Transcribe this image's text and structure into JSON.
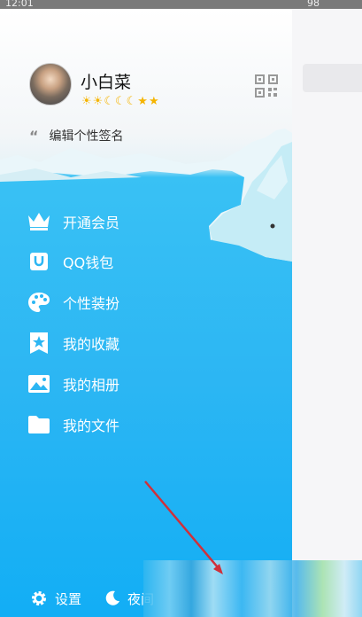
{
  "status": {
    "time": "12:01",
    "battery": "98"
  },
  "profile": {
    "name": "小白菜",
    "level_icons": [
      "☀",
      "☀",
      "☾",
      "☾",
      "☾",
      "★",
      "★"
    ],
    "signature_quote": "“",
    "signature": "编辑个性签名"
  },
  "menu": [
    {
      "label": "开通会员",
      "icon": "crown-icon"
    },
    {
      "label": "QQ钱包",
      "icon": "wallet-icon"
    },
    {
      "label": "个性装扮",
      "icon": "palette-icon"
    },
    {
      "label": "我的收藏",
      "icon": "star-bookmark-icon"
    },
    {
      "label": "我的相册",
      "icon": "photo-icon"
    },
    {
      "label": "我的文件",
      "icon": "folder-icon"
    }
  ],
  "bottom": {
    "settings": "设置",
    "night": "夜间"
  },
  "colors": {
    "accent": "#2cb6f3",
    "arrow": "#d0303a",
    "level": "#f5b400"
  }
}
